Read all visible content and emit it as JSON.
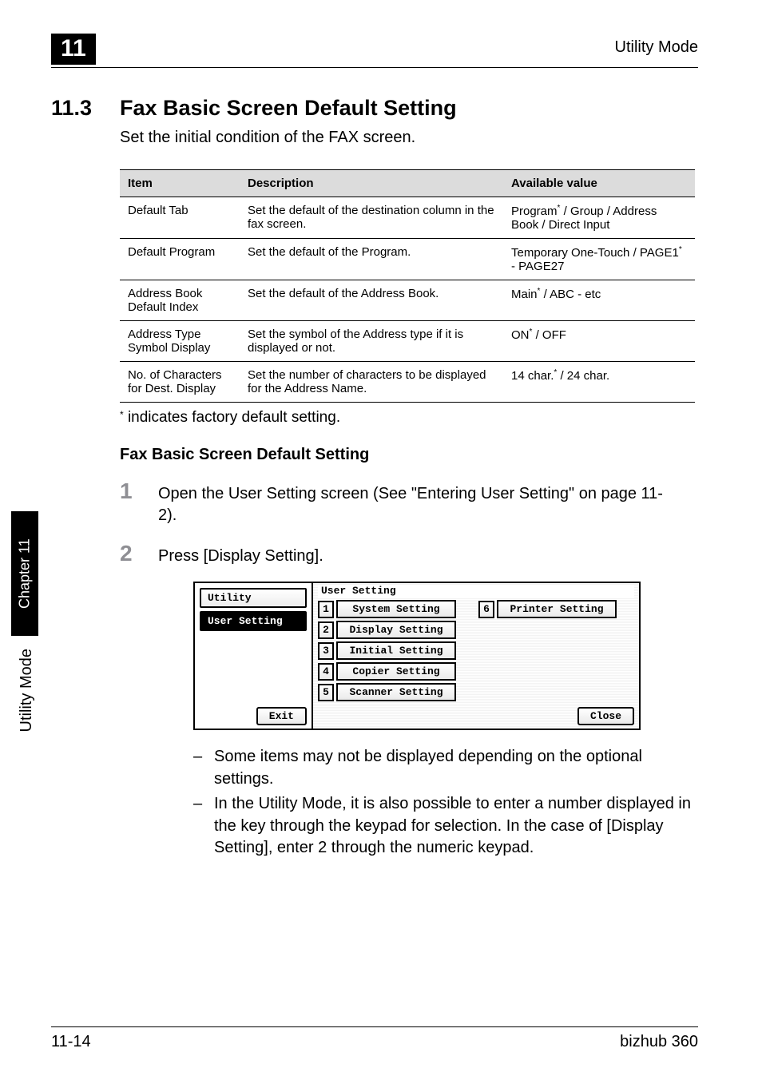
{
  "header": {
    "chapter_badge": "11",
    "running_title": "Utility Mode"
  },
  "section": {
    "number": "11.3",
    "title": "Fax Basic Screen Default Setting",
    "intro": "Set the initial condition of the FAX screen."
  },
  "table": {
    "headers": {
      "item": "Item",
      "description": "Description",
      "available": "Available value"
    },
    "rows": [
      {
        "item": "Default Tab",
        "desc": "Set the default of the destination column in the fax screen.",
        "avail_pre": "Program",
        "avail_post": " / Group / Address Book / Direct Input"
      },
      {
        "item": "Default Program",
        "desc": "Set the default of the Program.",
        "avail_pre": "Temporary One-Touch / PAGE1",
        "avail_post": " - PAGE27"
      },
      {
        "item": "Address Book Default Index",
        "desc": "Set the default of the Address Book.",
        "avail_pre": "Main",
        "avail_post": " / ABC - etc"
      },
      {
        "item": "Address Type Symbol Display",
        "desc": "Set the symbol of the Address type if it is displayed or not.",
        "avail_pre": "ON",
        "avail_post": " / OFF"
      },
      {
        "item": "No. of Characters for Dest. Display",
        "desc": "Set the number of characters to be displayed for the Address Name.",
        "avail_pre": "14 char.",
        "avail_post": " / 24 char."
      }
    ]
  },
  "footnote": " indicates factory default setting.",
  "subhead": "Fax Basic Screen Default Setting",
  "steps": {
    "one_num": "1",
    "one_text": "Open the User Setting screen (See \"Entering User Setting\" on page 11-2).",
    "two_num": "2",
    "two_text": "Press [Display Setting]."
  },
  "screen": {
    "left_title": "Utility",
    "left_tab": "User Setting",
    "exit": "Exit",
    "right_title": "User Setting",
    "items": [
      {
        "n": "1",
        "label": "System Setting"
      },
      {
        "n": "2",
        "label": "Display Setting"
      },
      {
        "n": "3",
        "label": "Initial Setting"
      },
      {
        "n": "4",
        "label": "Copier Setting"
      },
      {
        "n": "5",
        "label": "Scanner Setting"
      }
    ],
    "item6": {
      "n": "6",
      "label": "Printer Setting"
    },
    "close": "Close"
  },
  "bullets": {
    "b1": "Some items may not be displayed depending on the optional settings.",
    "b2": "In the Utility Mode, it is also possible to enter a number displayed in the key through the keypad for selection. In the case of [Display Setting], enter 2 through the numeric keypad."
  },
  "side": {
    "tab": "Chapter 11",
    "label": "Utility Mode"
  },
  "footer": {
    "left": "11-14",
    "right": "bizhub 360"
  }
}
